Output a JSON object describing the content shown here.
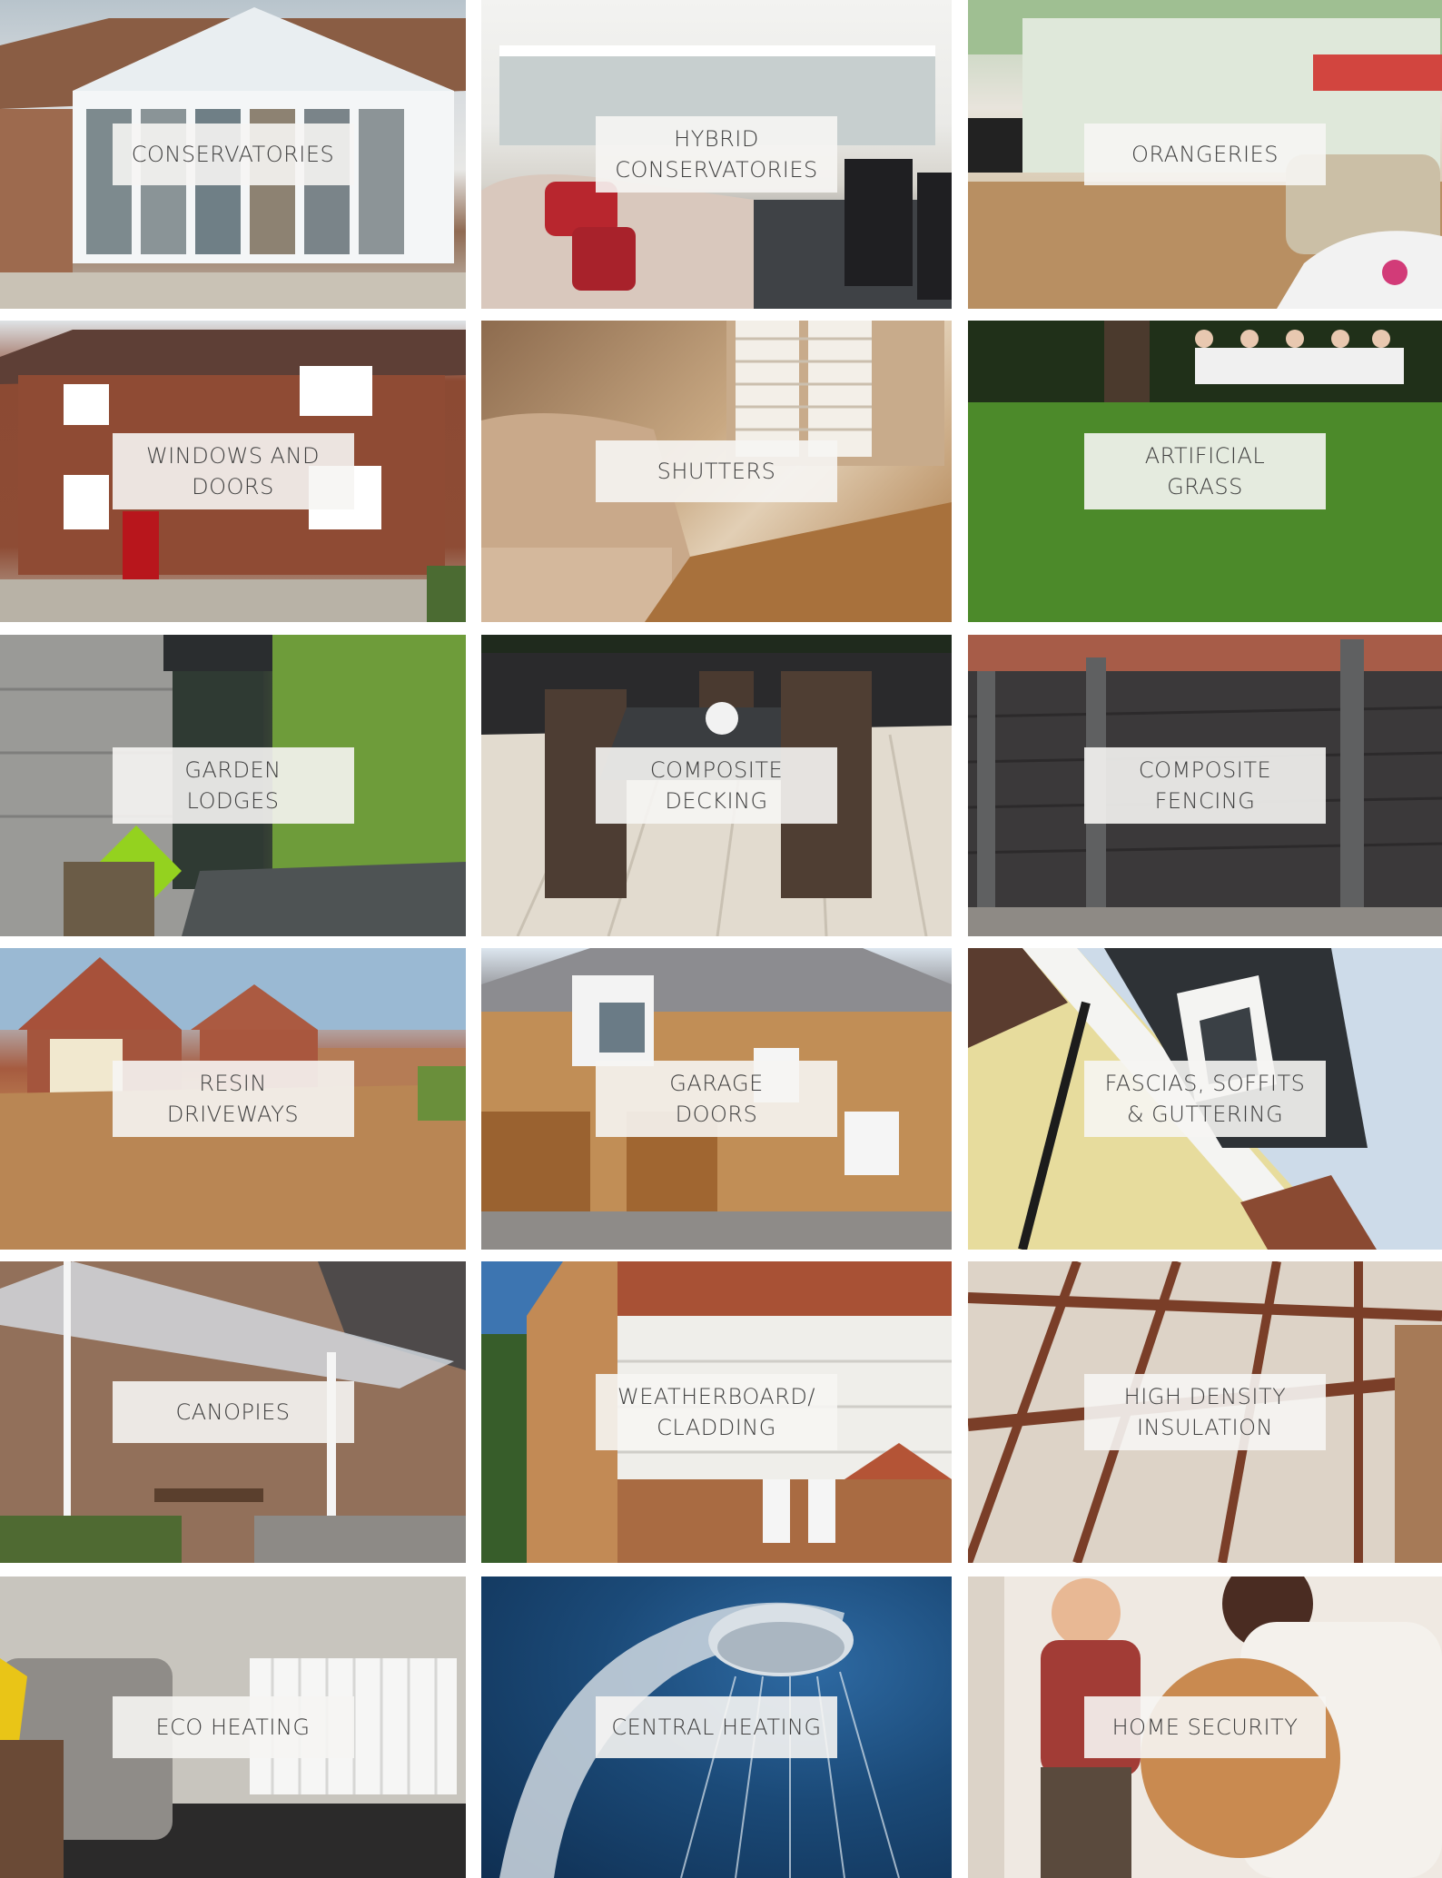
{
  "services": [
    {
      "id": "conservatories",
      "lines": [
        "CONSERVATORIES"
      ]
    },
    {
      "id": "hybrid-conservatories",
      "lines": [
        "HYBRID",
        "CONSERVATORIES"
      ]
    },
    {
      "id": "orangeries",
      "lines": [
        "ORANGERIES"
      ]
    },
    {
      "id": "windows-and-doors",
      "lines": [
        "WINDOWS AND",
        "DOORS"
      ]
    },
    {
      "id": "shutters",
      "lines": [
        "SHUTTERS"
      ]
    },
    {
      "id": "artificial-grass",
      "lines": [
        "ARTIFICIAL",
        "GRASS"
      ]
    },
    {
      "id": "garden-lodges",
      "lines": [
        "GARDEN",
        "LODGES"
      ]
    },
    {
      "id": "composite-decking",
      "lines": [
        "COMPOSITE",
        "DECKING"
      ]
    },
    {
      "id": "composite-fencing",
      "lines": [
        "COMPOSITE",
        "FENCING"
      ]
    },
    {
      "id": "resin-driveways",
      "lines": [
        "RESIN",
        "DRIVEWAYS"
      ]
    },
    {
      "id": "garage-doors",
      "lines": [
        "GARAGE",
        "DOORS"
      ]
    },
    {
      "id": "fascias-soffits-guttering",
      "lines": [
        "FASCIAS, SOFFITS",
        "& GUTTERING"
      ]
    },
    {
      "id": "canopies",
      "lines": [
        "CANOPIES"
      ]
    },
    {
      "id": "weatherboard-cladding",
      "lines": [
        "WEATHERBOARD/",
        "CLADDING"
      ]
    },
    {
      "id": "high-density-insulation",
      "lines": [
        "HIGH DENSITY",
        "INSULATION"
      ]
    },
    {
      "id": "eco-heating",
      "lines": [
        "ECO HEATING"
      ]
    },
    {
      "id": "central-heating",
      "lines": [
        "CENTRAL HEATING"
      ]
    },
    {
      "id": "home-security",
      "lines": [
        "HOME SECURITY"
      ]
    }
  ],
  "colors": {
    "label_background": "#f6f5f3",
    "label_text": "#3e3e3e",
    "page_background": "#ffffff"
  }
}
